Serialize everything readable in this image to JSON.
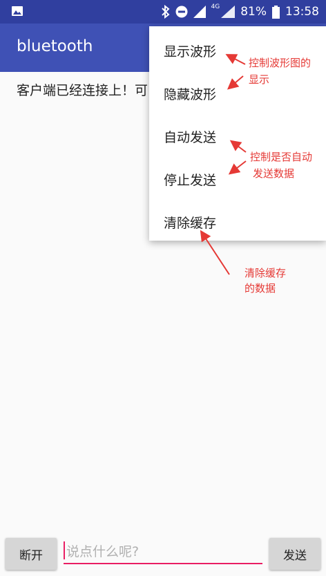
{
  "status_bar": {
    "bluetooth_icon": "bluetooth-icon",
    "dnd_icon": "do-not-disturb-icon",
    "signal_icon": "signal-icon",
    "network_type": "4G",
    "battery_percent": "81%",
    "time": "13:58"
  },
  "app_bar": {
    "title": "bluetooth"
  },
  "main": {
    "status_text": "客户端已经连接上！可"
  },
  "menu": {
    "items": [
      {
        "label": "显示波形"
      },
      {
        "label": "隐藏波形"
      },
      {
        "label": "自动发送"
      },
      {
        "label": "停止发送"
      },
      {
        "label": "清除缓存"
      }
    ]
  },
  "annotations": {
    "waveform_line1": "控制波形图的",
    "waveform_line2": "显示",
    "auto_line1": "控制是否自动",
    "auto_line2": "发送数据",
    "clear_line1": "清除缓存",
    "clear_line2": "的数据"
  },
  "bottom": {
    "disconnect_label": "断开",
    "input_placeholder": "说点什么呢?",
    "send_label": "发送"
  },
  "colors": {
    "status_bar": "#303f9f",
    "app_bar": "#3f51b5",
    "accent": "#e91e63",
    "annotation": "#e53935"
  }
}
